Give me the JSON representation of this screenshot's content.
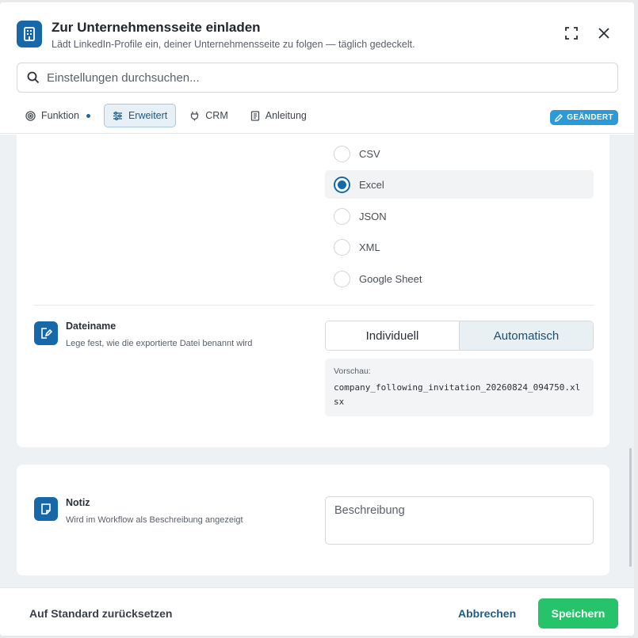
{
  "header": {
    "title": "Zur Unternehmensseite einladen",
    "subtitle": "Lädt LinkedIn-Profile ein, deiner Unternehmensseite zu folgen — täglich gedeckelt.",
    "app_icon": "building-icon"
  },
  "search": {
    "placeholder": "Einstellungen durchsuchen..."
  },
  "tabs": [
    {
      "label": "Funktion",
      "icon": "target-icon",
      "has_dot": true
    },
    {
      "label": "Erweitert",
      "icon": "sliders-icon",
      "active": true
    },
    {
      "label": "CRM",
      "icon": "plug-icon"
    },
    {
      "label": "Anleitung",
      "icon": "book-icon"
    }
  ],
  "badge": {
    "label": "GEÄNDERT",
    "icon": "pencil-icon"
  },
  "format": {
    "options": [
      "CSV",
      "Excel",
      "JSON",
      "XML",
      "Google Sheet"
    ],
    "selected": "Excel"
  },
  "filename": {
    "title": "Dateiname",
    "description": "Lege fest, wie die exportierte Datei benannt wird",
    "options": [
      "Individuell",
      "Automatisch"
    ],
    "selected": "Automatisch",
    "preview_label": "Vorschau:",
    "preview_value": "company_following_invitation_20260824_094750.xlsx"
  },
  "note": {
    "title": "Notiz",
    "description": "Wird im Workflow als Beschreibung angezeigt",
    "placeholder": "Beschreibung"
  },
  "footer": {
    "reset_label": "Auf Standard zurücksetzen",
    "cancel_label": "Abbrechen",
    "save_label": "Speichern"
  },
  "colors": {
    "accent": "#1668a8",
    "save": "#27c36a",
    "badge": "#2b9ad6"
  }
}
